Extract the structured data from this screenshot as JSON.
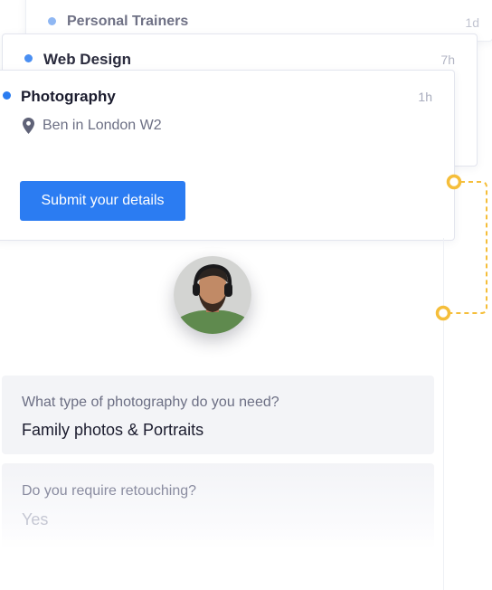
{
  "cards": [
    {
      "title": "Personal Trainers",
      "time": "1d"
    },
    {
      "title": "Web Design",
      "time": "7h"
    },
    {
      "title": "Photography",
      "time": "1h",
      "location": "Ben in London W2",
      "button": "Submit your details"
    }
  ],
  "questions": [
    {
      "label": "What type of photography do you need?",
      "answer": "Family photos & Portraits"
    },
    {
      "label": "Do you require retouching?",
      "answer": "Yes"
    }
  ],
  "colors": {
    "accent": "#2b7cf2",
    "connector": "#f5be3a",
    "question_bg": "#f3f4f7"
  },
  "icons": {
    "location": "map-pin-icon",
    "avatar": "user-avatar"
  }
}
